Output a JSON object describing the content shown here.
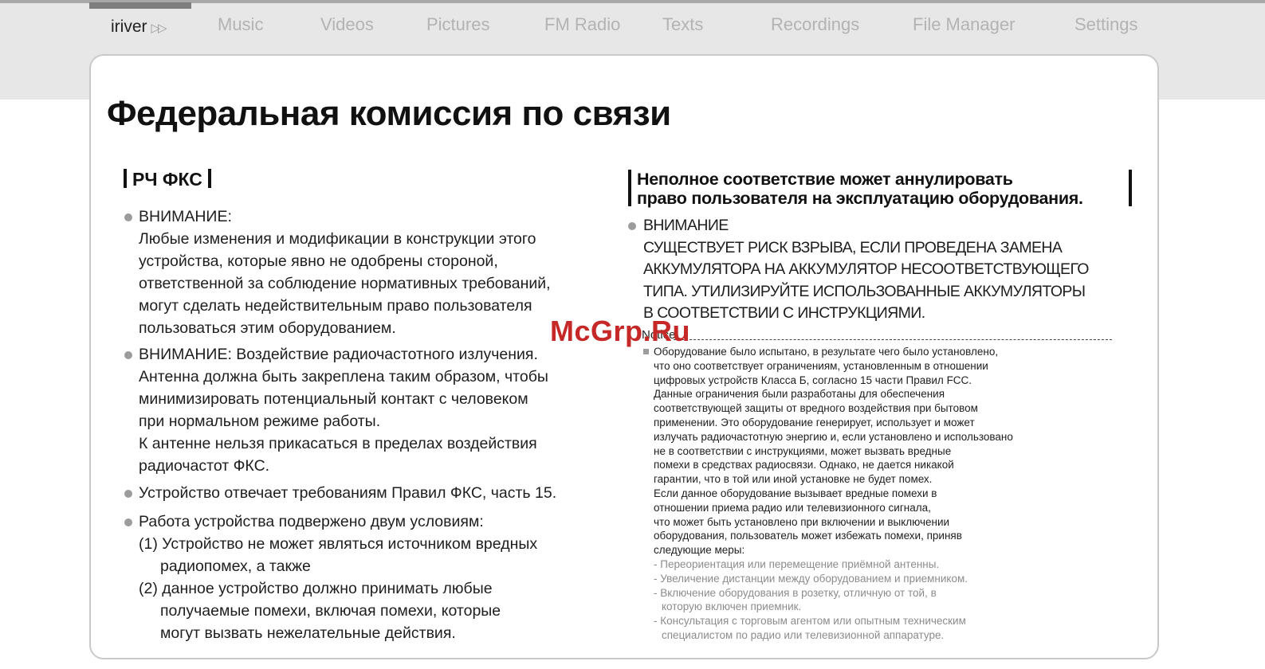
{
  "nav": {
    "brand": "iriver",
    "brand_arrows": "▷▷",
    "items": [
      "Music",
      "Videos",
      "Pictures",
      "FM Radio",
      "Texts",
      "Recordings",
      "File Manager",
      "Settings"
    ]
  },
  "page": {
    "title": "Федеральная комиссия по связи"
  },
  "left": {
    "heading": "РЧ ФКС",
    "warning1": {
      "label": "ВНИМАНИЕ:",
      "lines": [
        "Любые изменения и модификации в конструкции этого",
        "устройства, которые явно не одобрены стороной,",
        "ответственной за соблюдение нормативных требований,",
        "могут сделать недействительным право пользователя",
        "пользоваться этим оборудованием."
      ]
    },
    "warning2": {
      "lines": [
        "ВНИМАНИЕ: Воздействие радиочастотного излучения.",
        "Антенна должна быть закреплена таким образом, чтобы",
        "минимизировать потенциальный контакт с человеком",
        "при нормальном режиме работы.",
        "К антенне нельзя прикасаться в пределах воздействия",
        "радиочастот ФКС."
      ]
    },
    "compliance": "Устройство отвечает требованиям Правил ФКС, часть 15.",
    "conditions": {
      "intro": "Работа устройства подвержено двум условиям:",
      "c1_first": "(1) Устройство не может являться источником вредных",
      "c1_rest": "радиопомех, а также",
      "c2_first": "(2) данное устройство должно принимать любые",
      "c2_rest1": "получаемые помехи, включая помехи, которые",
      "c2_rest2": "могут вызвать нежелательные действия."
    }
  },
  "right": {
    "heading_line1": "Неполное соответствие может аннулировать",
    "heading_line2": "право пользователя на эксплуатацию оборудования.",
    "warning_label": "ВНИМАНИЕ",
    "warning_lines": [
      "СУЩЕСТВУЕТ РИСК ВЗРЫВА, ЕСЛИ ПРОВЕДЕНА ЗАМЕНА",
      "АККУМУЛЯТОРА НА АККУМУЛЯТОР НЕСООТВЕТСТВУЮЩЕГО",
      "ТИПА. УТИЛИЗИРУЙТЕ ИСПОЛЬЗОВАННЫЕ АККУМУЛЯТОРЫ",
      "В СООТВЕТСТВИИ С ИНСТРУКЦИЯМИ."
    ],
    "notice_label": "Notice",
    "notice_lines": [
      "Оборудование было испытано, в результате чего было установлено,",
      "что оно соответствует ограничениям, установленным в отношении",
      "цифровых устройств Класса Б, согласно 15 части Правил FCC.",
      "Данные ограничения были разработаны для обеспечения",
      "соответствующей защиты от вредного воздействия при бытовом",
      "применении. Это оборудование генерирует, использует и может",
      "излучать радиочастотную энергию и, если установлено и использовано",
      "не в соответствии с инструкциями, может вызвать вредные",
      "помехи в средствах радиосвязи. Однако, не дается никакой",
      "гарантии, что в той или иной установке не будет помех.",
      "Если данное оборудование вызывает вредные помехи в",
      "отношении приема радио или телевизионного сигнала,",
      "что может быть установлено при включении и выключении",
      "оборудования, пользователь может избежать помехи, приняв",
      "следующие меры:"
    ],
    "measures": {
      "m1": "- Переориентация или перемещение приёмной антенны.",
      "m2": "- Увеличение дистанции между оборудованием и приемником.",
      "m3": "- Включение оборудования в розетку, отличную от той, в",
      "m3_cont": "которую включен приемник.",
      "m4": "- Консультация с торговым агентом или опытным техническим",
      "m4_cont": "специалистом по радио или телевизионной аппаратуре."
    }
  },
  "watermark": "McGrp.Ru"
}
